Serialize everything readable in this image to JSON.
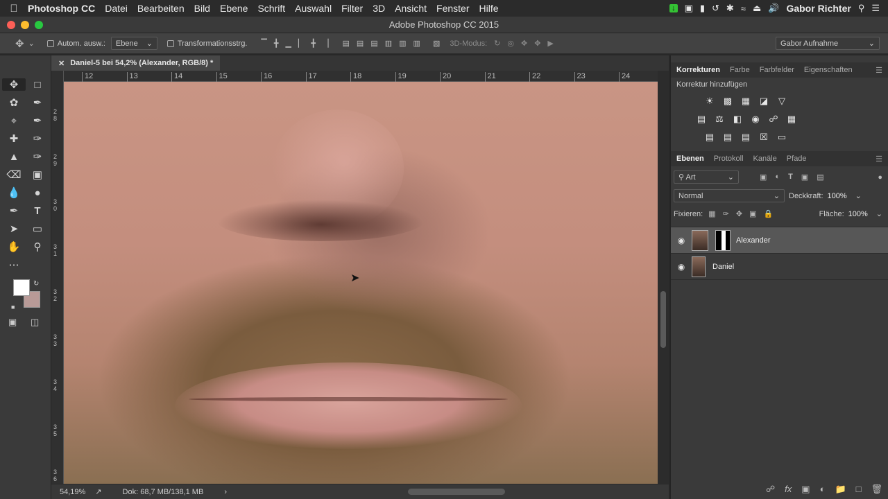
{
  "menubar": {
    "app_name": "Photoshop CC",
    "items": [
      "Datei",
      "Bearbeiten",
      "Bild",
      "Ebene",
      "Schrift",
      "Auswahl",
      "Filter",
      "3D",
      "Ansicht",
      "Fenster",
      "Hilfe"
    ],
    "user": "Gabor Richter"
  },
  "window": {
    "title": "Adobe Photoshop CC 2015"
  },
  "options": {
    "auto_select_label": "Autom. ausw.:",
    "auto_select_value": "Ebene",
    "transform_label": "Transformationsstrg.",
    "mode_3d_label": "3D-Modus:",
    "workspace": "Gabor Aufnahme"
  },
  "document": {
    "tab_title": "Daniel-5 bei 54,2% (Alexander, RGB/8) *",
    "ruler_h": [
      "12",
      "13",
      "14",
      "15",
      "16",
      "17",
      "18",
      "19",
      "20",
      "21",
      "22",
      "23",
      "24"
    ],
    "ruler_v": [
      "2\n8",
      "2\n9",
      "3\n0",
      "3\n1",
      "3\n2",
      "3\n3",
      "3\n4",
      "3\n5",
      "3\n6"
    ]
  },
  "status": {
    "zoom": "54,19%",
    "doc_size": "Dok: 68,7 MB/138,1 MB"
  },
  "adjustments_panel": {
    "tabs": [
      "Korrekturen",
      "Farbe",
      "Farbfelder",
      "Eigenschaften"
    ],
    "title": "Korrektur hinzufügen"
  },
  "layers_panel": {
    "tabs": [
      "Ebenen",
      "Protokoll",
      "Kanäle",
      "Pfade"
    ],
    "filter_kind": "Art",
    "blend_mode": "Normal",
    "opacity_label": "Deckkraft:",
    "opacity_value": "100%",
    "lock_label": "Fixieren:",
    "fill_label": "Fläche:",
    "fill_value": "100%",
    "layers": [
      {
        "name": "Alexander",
        "visible": true,
        "selected": true,
        "has_mask": true
      },
      {
        "name": "Daniel",
        "visible": true,
        "selected": false,
        "has_mask": false
      }
    ]
  },
  "colors": {
    "foreground": "#ffffff",
    "background": "#b89a97",
    "panel_bg": "#3a3a3a",
    "selected_layer": "#575757"
  }
}
